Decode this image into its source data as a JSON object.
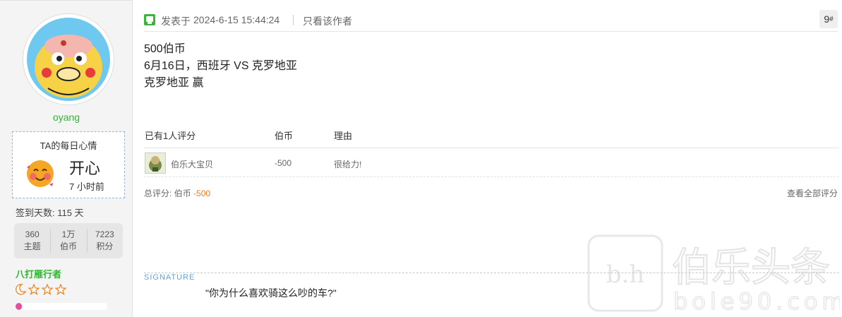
{
  "user": {
    "name": "oyang",
    "mood_title": "TA的每日心情",
    "mood": "开心",
    "mood_time": "7 小时前",
    "signin": "签到天数: 115 天",
    "stats": [
      {
        "value": "360",
        "label": "主题"
      },
      {
        "value": "1万",
        "label": "伯币"
      },
      {
        "value": "7223",
        "label": "积分"
      }
    ],
    "rank": "八打雁行者",
    "progress_fraction": 0.07,
    "colors": {
      "username": "#2db82d",
      "rank": "#2db82d",
      "progress": "#e54f9a"
    }
  },
  "post": {
    "posted_label": "发表于",
    "posted_time": "2024-6-15 15:44:24",
    "only_author": "只看该作者",
    "floor_number": "9",
    "floor_suffix": "#",
    "lines": [
      "500伯币",
      "6月16日，西班牙 VS 克罗地亚",
      "克罗地亚 赢"
    ]
  },
  "rating": {
    "header_count": "已有1人评分",
    "header_currency": "伯币",
    "header_reason": "理由",
    "rows": [
      {
        "user": "伯乐大宝贝",
        "amount": "-500",
        "reason": "很给力!"
      }
    ],
    "total_label": "总评分:",
    "total_currency": "伯币",
    "total_amount": "-500",
    "view_all": "查看全部评分"
  },
  "signature": {
    "label": "SIGNATURE",
    "text": "\"你为什么喜欢骑这么吵的车?\""
  },
  "watermark": {
    "text": "伯乐头条",
    "url": "bole90.com"
  }
}
